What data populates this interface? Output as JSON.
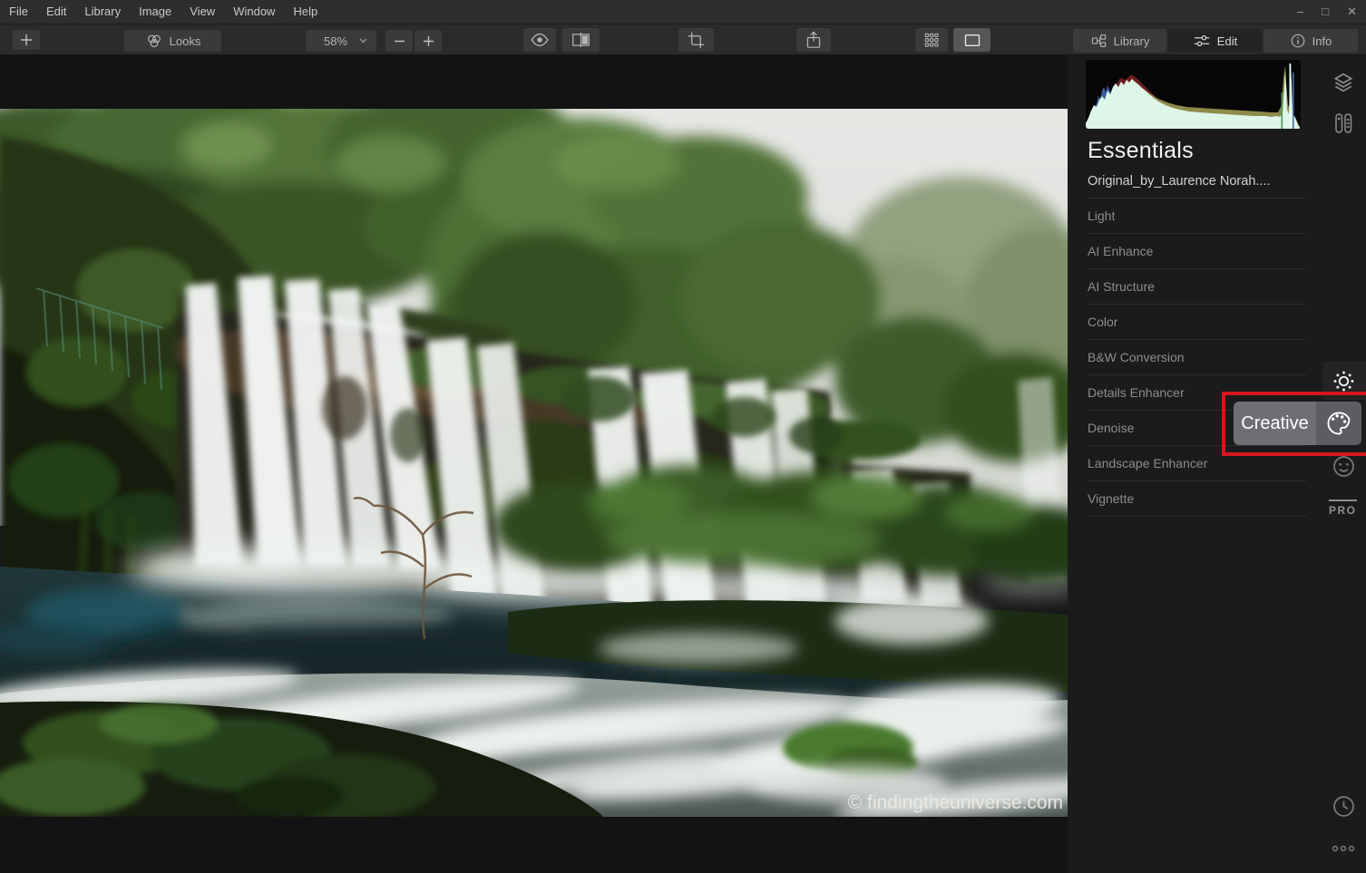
{
  "window": {
    "minimize": "–",
    "maximize": "□",
    "close": "✕"
  },
  "menubar": {
    "items": [
      "File",
      "Edit",
      "Library",
      "Image",
      "View",
      "Window",
      "Help"
    ]
  },
  "toolbar": {
    "looks_label": "Looks",
    "zoom_value": "58%"
  },
  "tabs": {
    "library": "Library",
    "edit": "Edit",
    "info": "Info"
  },
  "panel": {
    "title": "Essentials",
    "filename": "Original_by_Laurence Norah....",
    "filters": [
      "Light",
      "AI Enhance",
      "AI Structure",
      "Color",
      "B&W Conversion",
      "Details Enhancer",
      "Denoise",
      "Landscape Enhancer",
      "Vignette"
    ]
  },
  "sidebar": {
    "pro_label": "PRO"
  },
  "tooltip": {
    "label": "Creative"
  },
  "image": {
    "watermark": "© findingtheuniverse.com"
  },
  "icons": {
    "add": "plus",
    "looks": "venn-circles",
    "zoom_chevron": "chevron-down",
    "zoom_out": "minus",
    "zoom_in": "plus",
    "preview": "eye",
    "compare": "split-square",
    "crop": "crop-frame",
    "export": "share-up-arrow",
    "gallery_view": "grid-dots",
    "single_view": "square-outline",
    "library_tab": "collection-tree",
    "edit_tab": "sliders",
    "info_tab": "info-circle",
    "layers": "stacked-layers",
    "edits_panel": "capsules",
    "essentials": "sun",
    "creative": "palette",
    "portrait": "smiley-face",
    "history": "clock",
    "more": "three-dots"
  },
  "colors": {
    "annotation_red": "#d6161d",
    "tooltip_bg": "#706e75",
    "panel_bg": "#1b1b1b",
    "active_icon": "#f0f0f0"
  }
}
